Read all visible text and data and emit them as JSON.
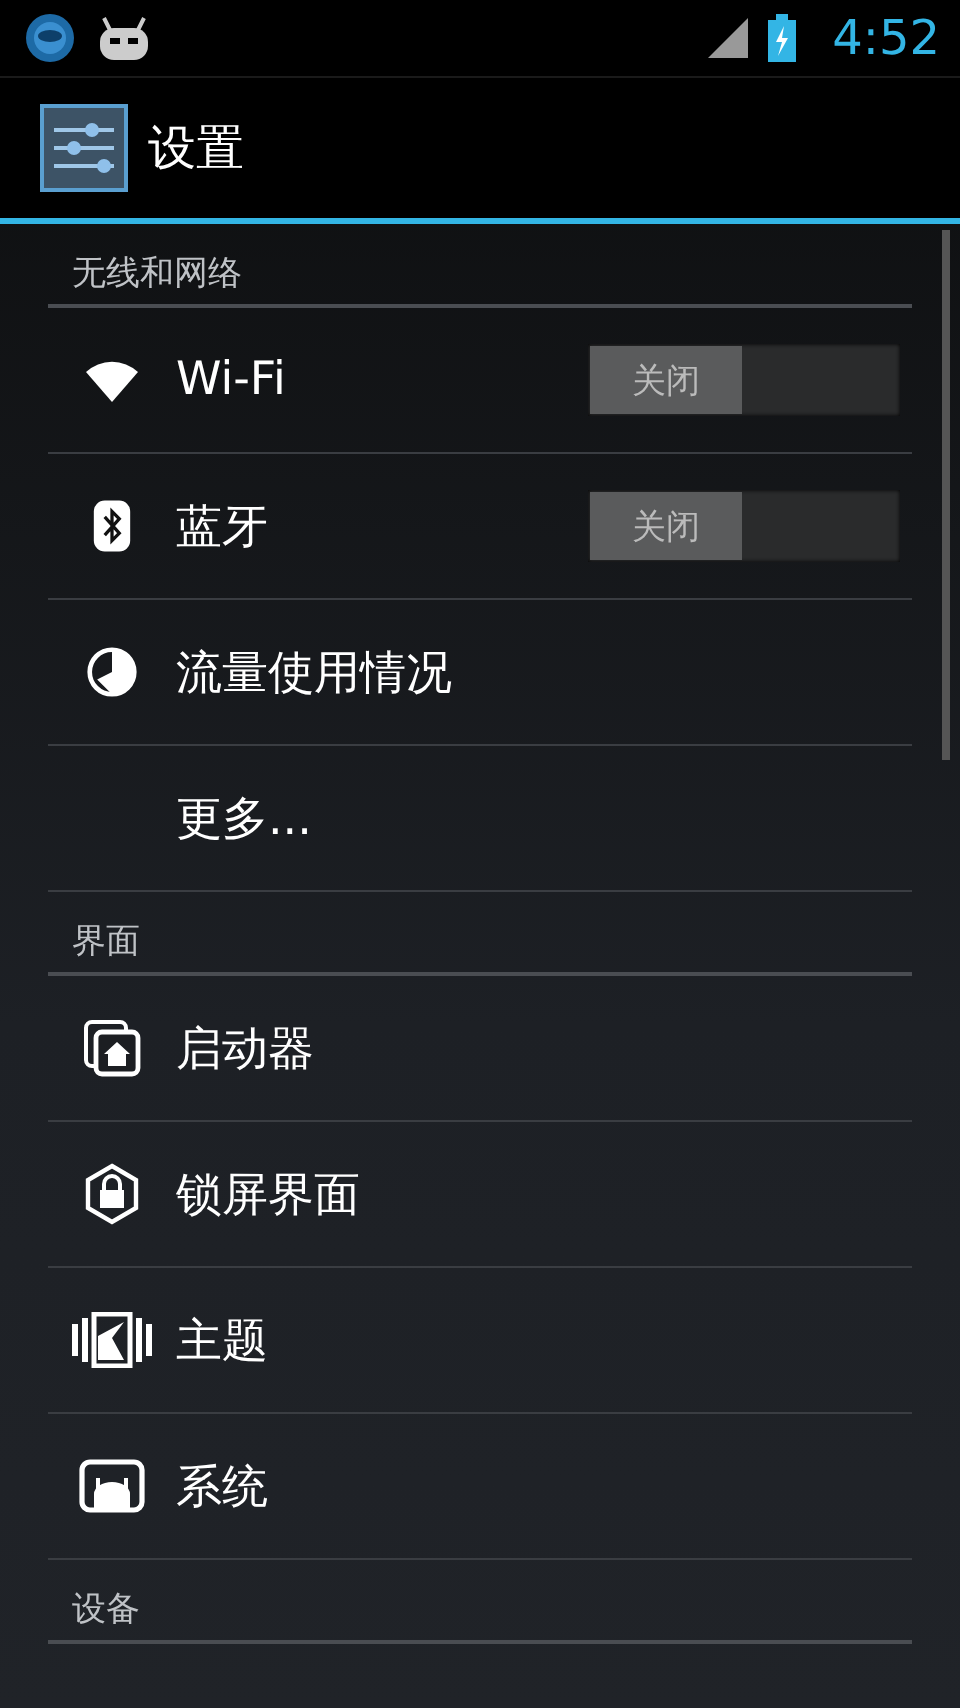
{
  "status_bar": {
    "time": "4:52"
  },
  "action_bar": {
    "title": "设置"
  },
  "sections": [
    {
      "title": "无线和网络",
      "items": [
        {
          "kind": "toggle",
          "label": "Wi-Fi",
          "switch": {
            "on": false,
            "text": "关闭"
          }
        },
        {
          "kind": "toggle",
          "label": "蓝牙",
          "switch": {
            "on": false,
            "text": "关闭"
          }
        },
        {
          "kind": "plain",
          "label": "流量使用情况"
        },
        {
          "kind": "plain",
          "label": "更多..."
        }
      ]
    },
    {
      "title": "界面",
      "items": [
        {
          "kind": "plain",
          "label": "启动器"
        },
        {
          "kind": "plain",
          "label": "锁屏界面"
        },
        {
          "kind": "plain",
          "label": "主题"
        },
        {
          "kind": "plain",
          "label": "系统"
        }
      ]
    },
    {
      "title": "设备"
    }
  ]
}
